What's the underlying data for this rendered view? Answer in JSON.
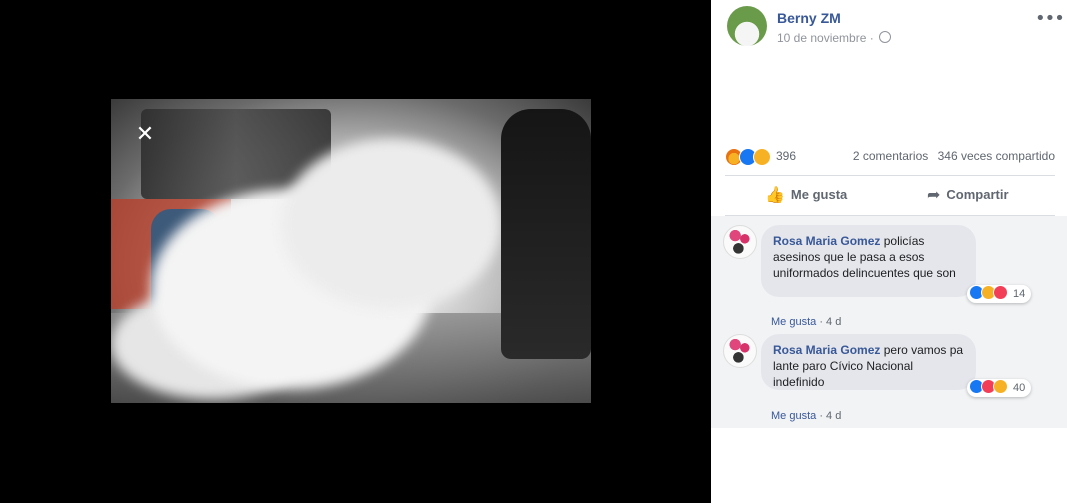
{
  "viewer": {
    "close_glyph": "✕"
  },
  "post": {
    "author": "Berny ZM",
    "date": "10 de noviembre",
    "date_separator": "·",
    "more_glyph": "•••",
    "reaction_count": "396",
    "comments_count": "2 comentarios",
    "shares_count": "346 veces compartido",
    "reactions": [
      "angry",
      "like",
      "sad"
    ]
  },
  "actions": {
    "like_label": "Me gusta",
    "like_icon": "👍",
    "share_label": "Compartir",
    "share_icon": "➦"
  },
  "comments": [
    {
      "author": "Rosa Maria Gomez",
      "text": "policías asesinos que le pasa a esos uniformados delincuentes que son",
      "reaction_count": "14",
      "reactions": [
        "like",
        "haha",
        "love"
      ],
      "like_label": "Me gusta",
      "separator": "·",
      "time": "4 d"
    },
    {
      "author": "Rosa Maria Gomez",
      "text": "pero vamos pa lante paro Cívico Nacional indefinido",
      "reaction_count": "40",
      "reactions": [
        "like",
        "love",
        "haha"
      ],
      "like_label": "Me gusta",
      "separator": "·",
      "time": "4 d"
    }
  ],
  "colors": {
    "link_blue": "#385898",
    "like_blue": "#1877f2",
    "love_red": "#f33e58",
    "haha_yellow": "#f7b125"
  }
}
